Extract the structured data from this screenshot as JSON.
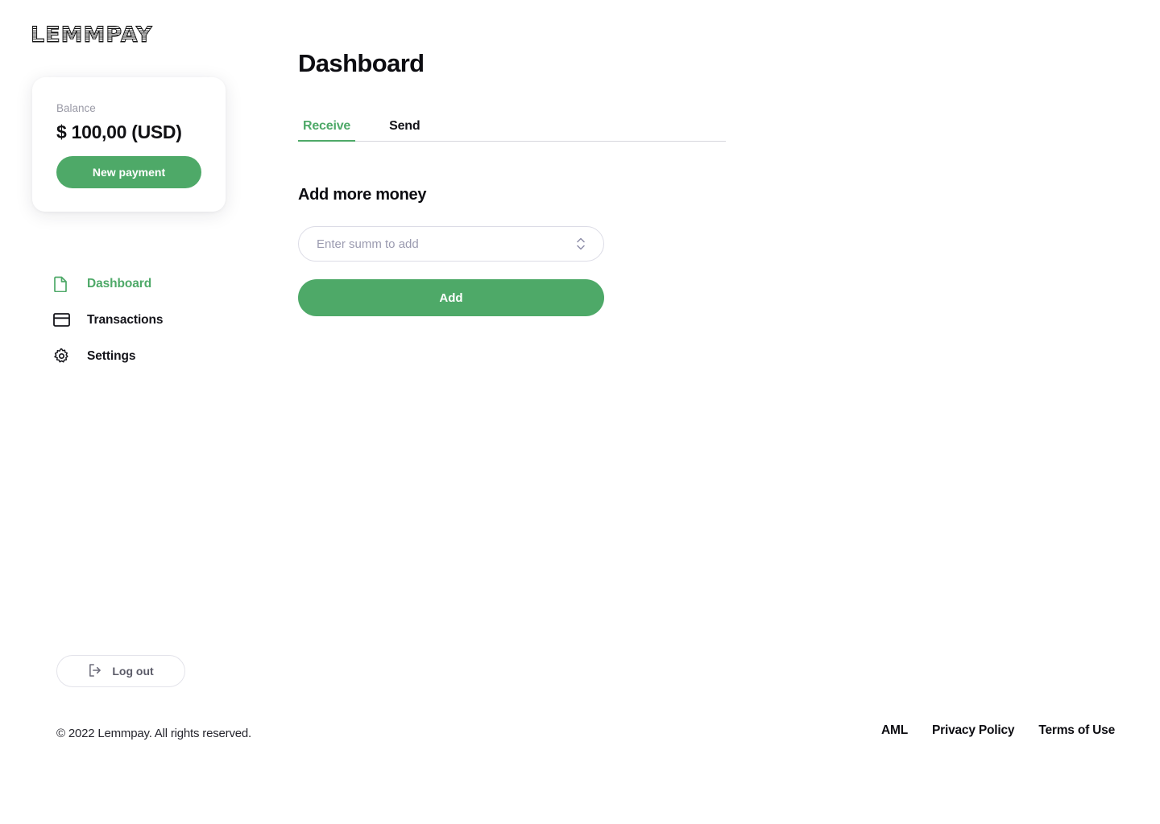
{
  "brand": {
    "logo_text": "LEMMPAY"
  },
  "balance_card": {
    "label": "Balance",
    "amount": "$ 100,00 (USD)",
    "new_payment_label": "New payment"
  },
  "sidebar": {
    "items": [
      {
        "label": "Dashboard",
        "icon": "file-icon",
        "active": true
      },
      {
        "label": "Transactions",
        "icon": "credit-card-icon",
        "active": false
      },
      {
        "label": "Settings",
        "icon": "gear-icon",
        "active": false
      }
    ],
    "logout_label": "Log out",
    "logout_icon": "logout-icon"
  },
  "main": {
    "title": "Dashboard",
    "tabs": [
      {
        "label": "Receive",
        "active": true
      },
      {
        "label": "Send",
        "active": false
      }
    ],
    "section_title": "Add more money",
    "amount_input": {
      "value": "",
      "placeholder": "Enter summ to add"
    },
    "add_button_label": "Add"
  },
  "footer": {
    "copyright": "© 2022 Lemmpay. All rights reserved.",
    "links": [
      {
        "label": "AML"
      },
      {
        "label": "Privacy Policy"
      },
      {
        "label": "Terms of Use"
      }
    ]
  },
  "colors": {
    "accent_green": "#4ea968",
    "text_dark": "#0d0d12",
    "muted": "#9a9aa6"
  }
}
